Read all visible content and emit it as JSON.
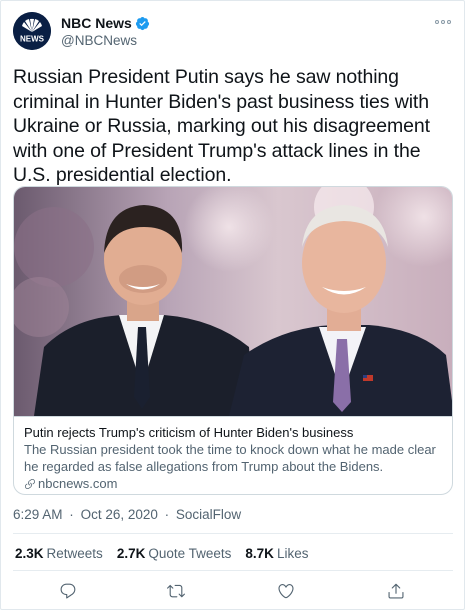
{
  "author": {
    "display_name": "NBC News",
    "handle": "@NBCNews",
    "avatar_icon": "nbc-peacock-logo",
    "avatar_text": "NEWS",
    "verified_icon": "verified-badge-icon",
    "verified_color": "#1d9bf0"
  },
  "tweet": {
    "text": "Russian President Putin says he saw nothing criminal in Hunter Biden's past business ties with Ukraine or Russia, marking out his disagreement with one of President Trump's attack lines in the U.S. presidential election."
  },
  "card": {
    "image_icon": "photo-two-men-smiling",
    "title": "Putin rejects Trump's criticism of Hunter Biden's business",
    "description": "The Russian president took the time to knock down what he made clear he regarded as false allegations from Trump about the Bidens.",
    "domain": "nbcnews.com",
    "domain_icon": "link-icon"
  },
  "meta": {
    "time": "6:29 AM",
    "date": "Oct 26, 2020",
    "separator": "·",
    "source": "SocialFlow"
  },
  "stats": {
    "retweets_count": "2.3K",
    "retweets_label": "Retweets",
    "quotes_count": "2.7K",
    "quotes_label": "Quote Tweets",
    "likes_count": "8.7K",
    "likes_label": "Likes"
  },
  "actions": {
    "reply_icon": "reply-icon",
    "retweet_icon": "retweet-icon",
    "like_icon": "heart-icon",
    "share_icon": "share-icon",
    "icon_color": "#536471"
  }
}
